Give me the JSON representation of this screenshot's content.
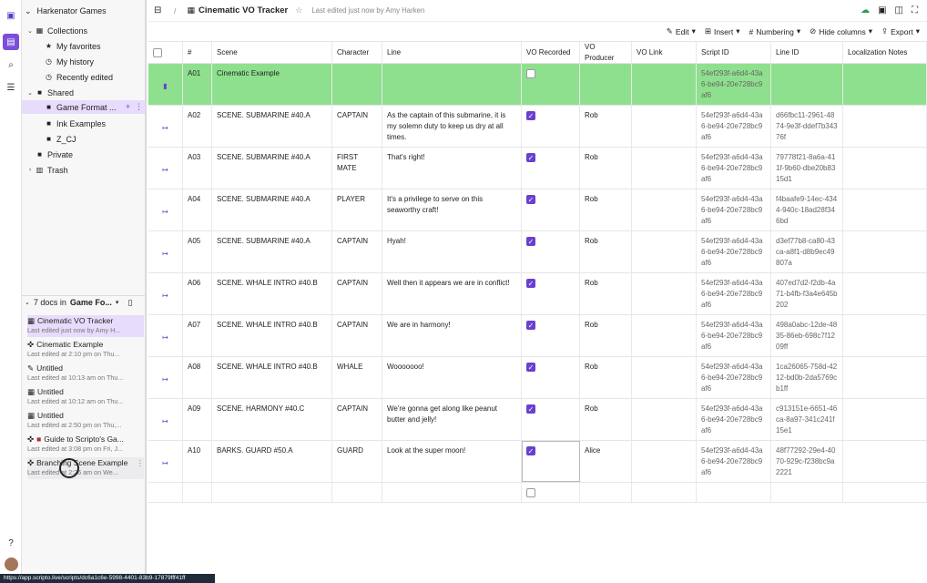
{
  "workspace": {
    "name": "Harkenator Games"
  },
  "tree": {
    "collections": "Collections",
    "favorites": "My favorites",
    "history": "My history",
    "recent": "Recently edited",
    "shared": "Shared",
    "game_format": "Game Format ...",
    "ink": "Ink Examples",
    "zcj": "Z_CJ",
    "private": "Private",
    "trash": "Trash"
  },
  "doc_section": {
    "prefix": "7 docs in",
    "folder": "Game Fo..."
  },
  "docs": [
    {
      "title": "Cinematic VO Tracker",
      "sub": "Last edited just now by Amy H..."
    },
    {
      "title": "Cinematic Example",
      "sub": "Last edited at 2:10 pm on Thu..."
    },
    {
      "title": "Untitled",
      "sub": "Last edited at 10:13 am on Thu..."
    },
    {
      "title": "Untitled",
      "sub": "Last edited at 10:12 am on Thu..."
    },
    {
      "title": "Untitled",
      "sub": "Last edited at 2:50 pm on Thu,..."
    },
    {
      "title": "Guide to Scripto's Ga...",
      "sub": "Last edited at 3:08 pm on Fri, J..."
    },
    {
      "title": "Branching Scene Example",
      "sub": "Last edited at 2:26 am on We..."
    }
  ],
  "header": {
    "sep": "/",
    "title": "Cinematic VO Tracker",
    "edited": "Last edited just now by Amy Harken"
  },
  "toolbar": {
    "edit": "Edit",
    "insert": "Insert",
    "numbering": "Numbering",
    "hide": "Hide columns",
    "export": "Export"
  },
  "columns": [
    "#",
    "Scene",
    "Character",
    "Line",
    "VO Recorded",
    "VO Producer",
    "VO Link",
    "Script ID",
    "Line ID",
    "Localization Notes"
  ],
  "rows": [
    {
      "num": "A01",
      "scene": "Cinematic Example",
      "char": "",
      "line": "",
      "rec": false,
      "prod": "",
      "sid": "54ef293f-a6d4-43a6-be94-20e728bc9af6",
      "lid": ""
    },
    {
      "num": "A02",
      "scene": "SCENE. SUBMARINE #40.A",
      "char": "CAPTAIN",
      "line": "As the captain of this submarine, it is my solemn duty to keep us dry at all times.",
      "rec": true,
      "prod": "Rob",
      "sid": "54ef293f-a6d4-43a6-be94-20e728bc9af6",
      "lid": "d66fbc11-2961-4874-9e3f-ddef7b34376f"
    },
    {
      "num": "A03",
      "scene": "SCENE. SUBMARINE #40.A",
      "char": "FIRST MATE",
      "line": "That's right!",
      "rec": true,
      "prod": "Rob",
      "sid": "54ef293f-a6d4-43a6-be94-20e728bc9af6",
      "lid": "79778f21-8a6a-411f-9b60-dbe20b8315d1"
    },
    {
      "num": "A04",
      "scene": "SCENE. SUBMARINE #40.A",
      "char": "PLAYER",
      "line": "It's a privilege to serve on this seaworthy craft!",
      "rec": true,
      "prod": "Rob",
      "sid": "54ef293f-a6d4-43a6-be94-20e728bc9af6",
      "lid": "f4baafe9-14ec-4344-940c-18ad28f346bd"
    },
    {
      "num": "A05",
      "scene": "SCENE. SUBMARINE #40.A",
      "char": "CAPTAIN",
      "line": "Hyah!",
      "rec": true,
      "prod": "Rob",
      "sid": "54ef293f-a6d4-43a6-be94-20e728bc9af6",
      "lid": "d3ef77b8-ca80-43ca-a8f1-d8b9ec49807a"
    },
    {
      "num": "A06",
      "scene": "SCENE. WHALE INTRO #40.B",
      "char": "CAPTAIN",
      "line": "Well then it appears we are in conflict!",
      "rec": true,
      "prod": "Rob",
      "sid": "54ef293f-a6d4-43a6-be94-20e728bc9af6",
      "lid": "407ed7d2-f2db-4a71-b4fb-f3a4e645b202"
    },
    {
      "num": "A07",
      "scene": "SCENE. WHALE INTRO #40.B",
      "char": "CAPTAIN",
      "line": "We are in harmony!",
      "rec": true,
      "prod": "Rob",
      "sid": "54ef293f-a6d4-43a6-be94-20e728bc9af6",
      "lid": "498a0abc-12de-4835-86eb-698c7f1209ff"
    },
    {
      "num": "A08",
      "scene": "SCENE. WHALE INTRO #40.B",
      "char": "WHALE",
      "line": "Wooooooo!",
      "rec": true,
      "prod": "Rob",
      "sid": "54ef293f-a6d4-43a6-be94-20e728bc9af6",
      "lid": "1ca26065-758d-4212-bd0b-2da5769cb1ff"
    },
    {
      "num": "A09",
      "scene": "SCENE. HARMONY #40.C",
      "char": "CAPTAIN",
      "line": "We're gonna get along like peanut butter and jelly!",
      "rec": true,
      "prod": "Rob",
      "sid": "54ef293f-a6d4-43a6-be94-20e728bc9af6",
      "lid": "c913151e-6651-46ca-8a97-341c241f15e1"
    },
    {
      "num": "A10",
      "scene": "BARKS. GUARD #50.A",
      "char": "GUARD",
      "line": "Look at the super moon!",
      "rec": true,
      "prod": "Alice",
      "sid": "54ef293f-a6d4-43a6-be94-20e728bc9af6",
      "lid": "48f77292-29e4-4070-929c-f238bc9a2221"
    }
  ],
  "status_url": "https://app.scripto.live/scripts/dc6a1c6e-5998-4401-83b9-17879fff41ff",
  "colors": {
    "accent": "#6a3fd1",
    "highlight": "#8ee08e"
  }
}
